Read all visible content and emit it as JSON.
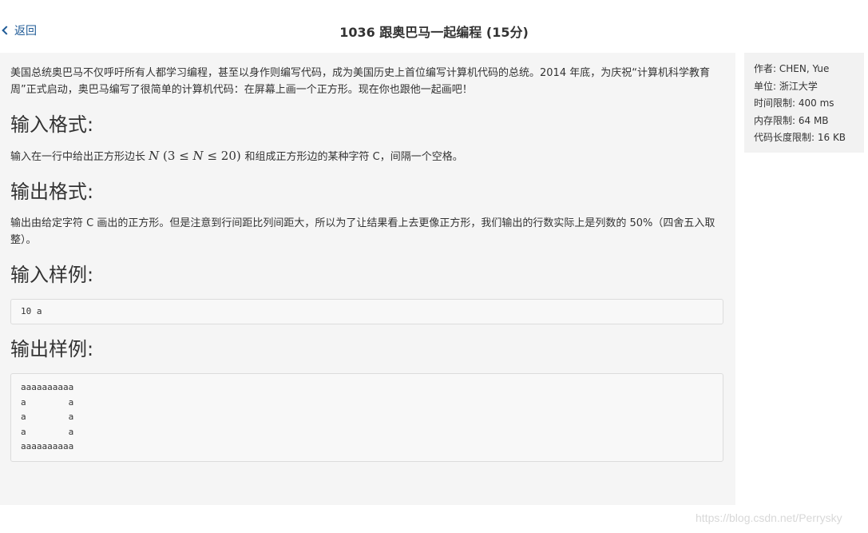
{
  "header": {
    "back_label": "返回",
    "title": "1036 跟奥巴马一起编程 (15分)"
  },
  "problem": {
    "description": "美国总统奥巴马不仅呼吁所有人都学习编程，甚至以身作则编写代码，成为美国历史上首位编写计算机代码的总统。2014 年底，为庆祝“计算机科学教育周”正式启动，奥巴马编写了很简单的计算机代码：在屏幕上画一个正方形。现在你也跟他一起画吧！",
    "input_heading": "输入格式:",
    "input_text_before": "输入在一行中给出正方形边长 ",
    "input_math_var": "N",
    "input_math_range_open": " (3 ≤ ",
    "input_math_var2": "N",
    "input_math_range_close": " ≤ 20) ",
    "input_text_after": "和组成正方形边的某种字符 C，间隔一个空格。",
    "output_heading": "输出格式:",
    "output_text": "输出由给定字符 C 画出的正方形。但是注意到行间距比列间距大，所以为了让结果看上去更像正方形，我们输出的行数实际上是列数的 50%（四舍五入取整）。",
    "sample_input_heading": "输入样例:",
    "sample_input": "10 a",
    "sample_output_heading": "输出样例:",
    "sample_output": "aaaaaaaaaa\na        a\na        a\na        a\naaaaaaaaaa"
  },
  "sidebar": {
    "author": "作者: CHEN, Yue",
    "unit": "单位: 浙江大学",
    "time_limit": "时间限制: 400 ms",
    "memory_limit": "内存限制: 64 MB",
    "code_limit": "代码长度限制: 16 KB"
  },
  "watermark": "https://blog.csdn.net/Perrysky"
}
